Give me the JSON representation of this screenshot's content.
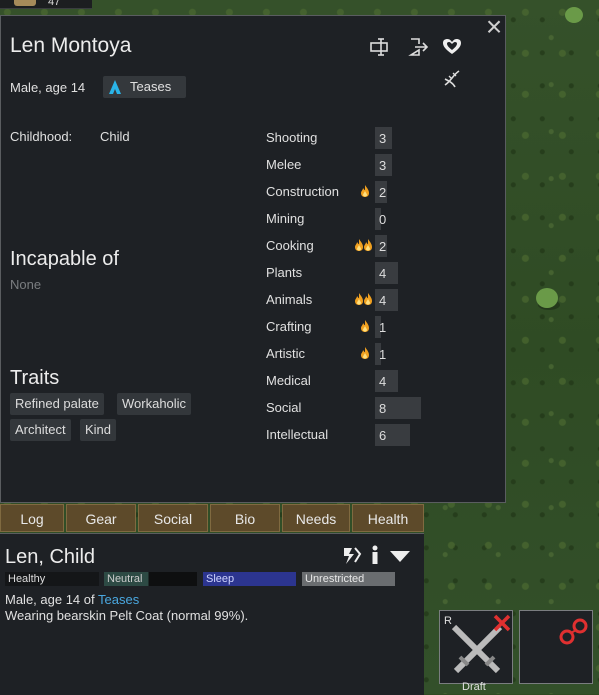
{
  "resources": {
    "count": "47",
    "icon": "wood-icon"
  },
  "panel": {
    "name": "Len Montoya",
    "subtitle": "Male, age 14",
    "ideology": {
      "label": "Teases",
      "icon": "ideoligion-icon",
      "color": "#2ab4e8"
    },
    "header_icons": [
      "rename-icon",
      "banish-icon",
      "heart-icon",
      "genes-icon"
    ],
    "childhood_label": "Childhood:",
    "childhood_value": "Child",
    "incapable_title": "Incapable of",
    "incapable_value": "None",
    "traits_title": "Traits",
    "traits": [
      "Refined palate",
      "Workaholic",
      "Architect",
      "Kind"
    ],
    "skills": [
      {
        "name": "Shooting",
        "level": "3",
        "passion": 0,
        "fill": 0.15
      },
      {
        "name": "Melee",
        "level": "3",
        "passion": 0,
        "fill": 0.15
      },
      {
        "name": "Construction",
        "level": "2",
        "passion": 1,
        "fill": 0.1
      },
      {
        "name": "Mining",
        "level": "0",
        "passion": 0,
        "fill": 0.0
      },
      {
        "name": "Cooking",
        "level": "2",
        "passion": 2,
        "fill": 0.1
      },
      {
        "name": "Plants",
        "level": "4",
        "passion": 0,
        "fill": 0.2
      },
      {
        "name": "Animals",
        "level": "4",
        "passion": 2,
        "fill": 0.2
      },
      {
        "name": "Crafting",
        "level": "1",
        "passion": 1,
        "fill": 0.05
      },
      {
        "name": "Artistic",
        "level": "1",
        "passion": 1,
        "fill": 0.05
      },
      {
        "name": "Medical",
        "level": "4",
        "passion": 0,
        "fill": 0.2
      },
      {
        "name": "Social",
        "level": "8",
        "passion": 0,
        "fill": 0.4
      },
      {
        "name": "Intellectual",
        "level": "6",
        "passion": 0,
        "fill": 0.3
      }
    ]
  },
  "tabs": [
    "Log",
    "Gear",
    "Social",
    "Bio",
    "Needs",
    "Health"
  ],
  "inspect": {
    "name": "Len, Child",
    "icons": [
      "draft-toggle-icon",
      "info-icon",
      "dropdown-icon"
    ],
    "status_bars": [
      {
        "label": "Healthy",
        "color": "#1e2125"
      },
      {
        "label": "Neutral",
        "color": "#2d4a44"
      },
      {
        "label": "Sleep",
        "color": "#2c3590"
      },
      {
        "label": "Unrestricted",
        "color": "#6a6d70"
      }
    ],
    "line1_prefix": "Male, age 14 of ",
    "line1_link": "Teases",
    "line2": "Wearing bearskin Pelt Coat (normal 99%)."
  },
  "gizmos": {
    "draft": {
      "label": "Draft",
      "hotkey": "R",
      "icon": "crossed-swords-icon"
    },
    "second": {
      "icon": "handcuffs-icon"
    }
  },
  "colors": {
    "panel_bg": "#1e2125",
    "tab_bg": "#5d4a2a",
    "flame": "#f0a020",
    "close_x": "#e03030"
  }
}
